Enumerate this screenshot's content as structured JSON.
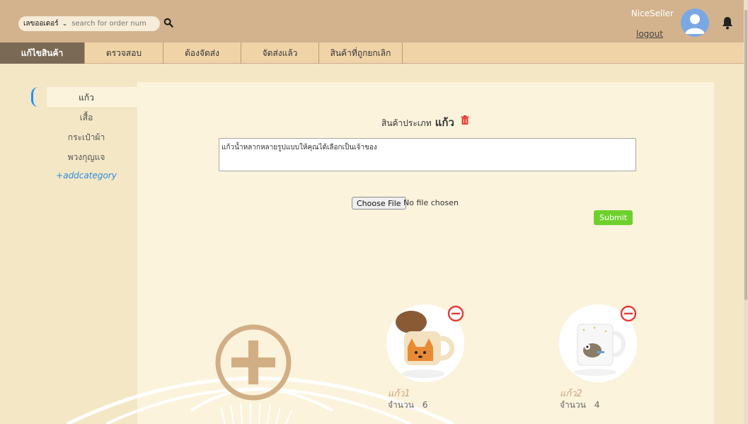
{
  "header": {
    "search_select": "เลขออเดอร์",
    "search_placeholder": "search for order num",
    "user_name": "NiceSeller",
    "logout_label": "logout"
  },
  "tabs": [
    {
      "label": "แก้ไขสินค้า",
      "active": true
    },
    {
      "label": "ตรวจสอบ",
      "active": false
    },
    {
      "label": "ต้องจัดส่ง",
      "active": false
    },
    {
      "label": "จัดส่งแล้ว",
      "active": false
    },
    {
      "label": "สินค้าที่ถูกยกเลิก",
      "active": false
    }
  ],
  "sidebar": {
    "categories": [
      {
        "label": "แก้ว",
        "active": true
      },
      {
        "label": "เสื้อ",
        "active": false
      },
      {
        "label": "กระเป๋าผ้า",
        "active": false
      },
      {
        "label": "พวงกุญแจ",
        "active": false
      }
    ],
    "add_category_label": "+addcategory"
  },
  "main": {
    "heading_prefix": "สินค้าประเภท",
    "heading_category": "แก้ว",
    "description": "แก้วน้ำหลากหลายรูปแบบให้คุณได้เลือกเป็นเจ้าของ",
    "choose_file_label": "Choose File",
    "file_status": "No file chosen",
    "submit_label": "Submit"
  },
  "products": [
    {
      "name": "แก้ว1",
      "qty_label": "จำนวน",
      "qty": "6"
    },
    {
      "name": "แก้ว2",
      "qty_label": "จำนวน",
      "qty": "4"
    }
  ],
  "colors": {
    "header_bg": "#d2b38d",
    "nav_bg": "#f0d4a8",
    "active_tab": "#7a6a55",
    "submit": "#6fd02d",
    "remove": "#e53935",
    "add_category": "#2a8be0"
  },
  "icons": [
    "search-icon",
    "avatar-icon",
    "bell-icon",
    "trash-icon",
    "remove-icon",
    "add-product-icon"
  ]
}
